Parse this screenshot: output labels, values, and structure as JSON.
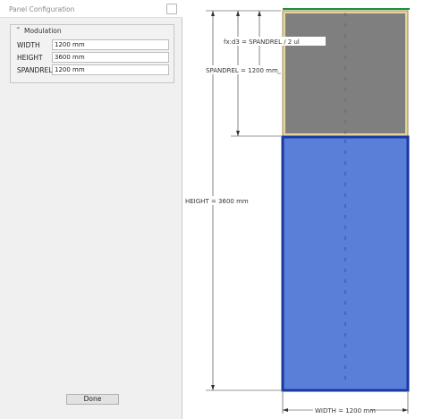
{
  "window": {
    "title": "Panel Configuration",
    "close_label": "×"
  },
  "modulation": {
    "title": "Modulation",
    "fields": [
      {
        "label": "WIDTH",
        "value": "1200 mm"
      },
      {
        "label": "HEIGHT",
        "value": "3600 mm"
      },
      {
        "label": "SPANDREL",
        "value": "1200 mm"
      }
    ]
  },
  "footer": {
    "done_label": "Done"
  },
  "drawing": {
    "formula_label": "fx:d3 = SPANDREL / 2 ul",
    "spandrel_dim": "SPANDREL = 1200 mm",
    "height_dim": "HEIGHT = 3600 mm",
    "width_dim": "WIDTH = 1200 mm",
    "colors": {
      "spandrel_fill": "#7f7f7f",
      "spandrel_frame": "#e4d69a",
      "vision_fill": "#5a7fd8",
      "vision_border": "#1a3aa0",
      "top_edge": "#1f8f3f"
    }
  }
}
